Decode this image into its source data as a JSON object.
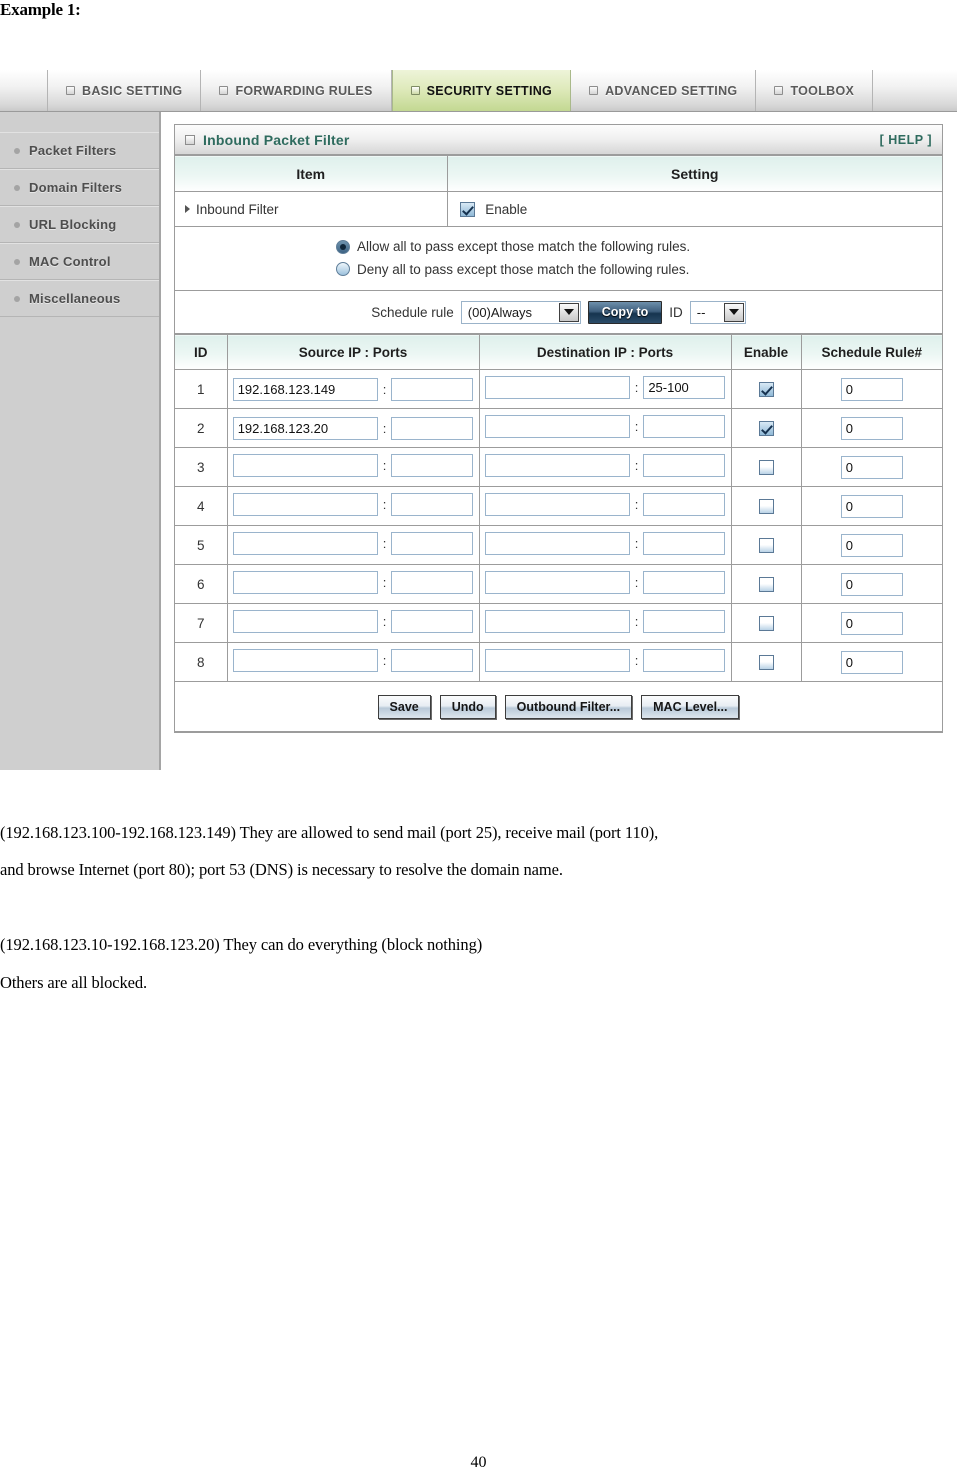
{
  "document": {
    "heading": "Example 1:",
    "page_number": "40",
    "paragraphs": [
      "(192.168.123.100-192.168.123.149) They are allowed to send mail (port 25), receive mail (port 110),",
      "and browse Internet (port 80); port 53 (DNS) is necessary to resolve the domain name.",
      "(192.168.123.10-192.168.123.20) They can do everything (block nothing)",
      "Others are all blocked."
    ]
  },
  "router_ui": {
    "tabs": [
      {
        "label": "BASIC SETTING",
        "active": false
      },
      {
        "label": "FORWARDING RULES",
        "active": false
      },
      {
        "label": "SECURITY SETTING",
        "active": true
      },
      {
        "label": "ADVANCED SETTING",
        "active": false
      },
      {
        "label": "TOOLBOX",
        "active": false
      }
    ],
    "sidebar": {
      "items": [
        {
          "label": "Packet Filters"
        },
        {
          "label": "Domain Filters"
        },
        {
          "label": "URL Blocking"
        },
        {
          "label": "MAC Control"
        },
        {
          "label": "Miscellaneous"
        }
      ]
    },
    "panel": {
      "title": "Inbound Packet Filter",
      "help_label": "[ HELP ]",
      "columns": {
        "item": "Item",
        "setting": "Setting"
      },
      "inbound_filter": {
        "label": "Inbound Filter",
        "enable_label": "Enable",
        "enabled": true
      },
      "policy": {
        "selected": "allow",
        "options": [
          {
            "id": "allow",
            "label": "Allow all to pass except those match the following rules.",
            "selected": true
          },
          {
            "id": "deny",
            "label": "Deny all to pass except those match the following rules.",
            "selected": false
          }
        ]
      },
      "schedule": {
        "label": "Schedule rule",
        "rule_value": "(00)Always",
        "copy_to_label": "Copy to",
        "id_label": "ID",
        "id_value": "--"
      },
      "rules_table": {
        "headers": [
          "ID",
          "Source IP : Ports",
          "Destination IP : Ports",
          "Enable",
          "Schedule Rule#"
        ],
        "rows": [
          {
            "id": "1",
            "src_ip": "192.168.123.149",
            "src_port": "",
            "dst_ip": "",
            "dst_port": "25-100",
            "enable": true,
            "sched": "0"
          },
          {
            "id": "2",
            "src_ip": "192.168.123.20",
            "src_port": "",
            "dst_ip": "",
            "dst_port": "",
            "enable": true,
            "sched": "0"
          },
          {
            "id": "3",
            "src_ip": "",
            "src_port": "",
            "dst_ip": "",
            "dst_port": "",
            "enable": false,
            "sched": "0"
          },
          {
            "id": "4",
            "src_ip": "",
            "src_port": "",
            "dst_ip": "",
            "dst_port": "",
            "enable": false,
            "sched": "0"
          },
          {
            "id": "5",
            "src_ip": "",
            "src_port": "",
            "dst_ip": "",
            "dst_port": "",
            "enable": false,
            "sched": "0"
          },
          {
            "id": "6",
            "src_ip": "",
            "src_port": "",
            "dst_ip": "",
            "dst_port": "",
            "enable": false,
            "sched": "0"
          },
          {
            "id": "7",
            "src_ip": "",
            "src_port": "",
            "dst_ip": "",
            "dst_port": "",
            "enable": false,
            "sched": "0"
          },
          {
            "id": "8",
            "src_ip": "",
            "src_port": "",
            "dst_ip": "",
            "dst_port": "",
            "enable": false,
            "sched": "0"
          }
        ]
      },
      "buttons": [
        {
          "label": "Save"
        },
        {
          "label": "Undo"
        },
        {
          "label": "Outbound Filter..."
        },
        {
          "label": "MAC Level..."
        }
      ]
    }
  },
  "colors": {
    "active_tab_green": "#c3d892",
    "panel_title_green": "#2e6b5e",
    "table_header_mint": "#dff0ec",
    "sidebar_gray": "#cfcfcf",
    "button_blue": "#16344f"
  }
}
